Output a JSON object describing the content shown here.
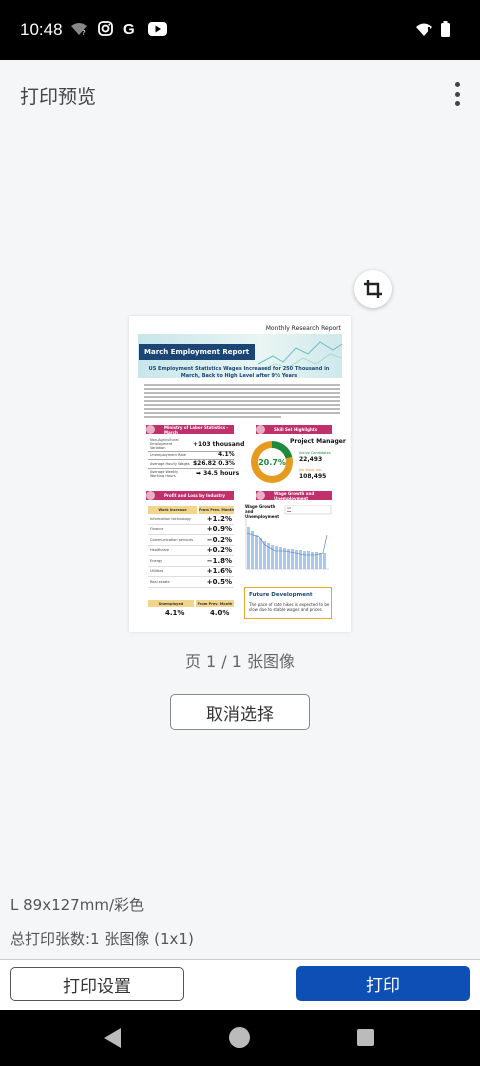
{
  "status_bar": {
    "time": "10:48"
  },
  "app_bar": {
    "title": "打印预览"
  },
  "document": {
    "header": "Monthly Research Report",
    "title": "March Employment Report",
    "subtitle": "US Employment Statistics   Wages Increased for 250 Thousand in March, Back to High Level after 9½ Years",
    "section_labor": "Ministry of Labor Statistics - March",
    "labor_rows": [
      {
        "label": "Non-Agricultural Employment Variation",
        "value": "+103 thousand"
      },
      {
        "label": "Unemployment Rate",
        "value": "4.1%"
      },
      {
        "label": "Average Hourly Wages",
        "value": "$26.82 0.3%"
      },
      {
        "label": "Average Weekly Working Hours",
        "value": "➡ 34.5 hours"
      }
    ],
    "section_skill": "Skill Set Highlights",
    "skill_role": "Project Manager",
    "skill_percent": "20.7%",
    "active_candidates_label": "Active Candidates",
    "active_candidates": "22,493",
    "job_count_label": "Job Want Ads",
    "job_count": "108,495",
    "section_pl": "Profit and Loss by Industry",
    "pl_header": [
      "Work Increase",
      "From Prev. Month"
    ],
    "pl_rows": [
      {
        "label": "Information technology",
        "value": "+1.2%"
      },
      {
        "label": "Finance",
        "value": "+0.9%"
      },
      {
        "label": "Communication services",
        "value": "−0.2%"
      },
      {
        "label": "Healthcare",
        "value": "+0.2%"
      },
      {
        "label": "Energy",
        "value": "−1.8%"
      },
      {
        "label": "Utilities",
        "value": "+1.6%"
      },
      {
        "label": "Real estate",
        "value": "+0.5%"
      }
    ],
    "unemployed_label": "Unemployed",
    "unemployed_value": "4.1%",
    "from_prev_label": "From Prev. Month",
    "from_prev_value": "4.0%",
    "section_wage": "Wage Growth and Unemployment",
    "chart_title": "Wage Growth and Unemployment",
    "future_title": "Future Development",
    "future_text": "The pace of rate hikes is expected to be slow due to stable wages and prices."
  },
  "page_indicator": "页 1 / 1 张图像",
  "deselect_label": "取消选择",
  "paper_size": "L 89x127mm/彩色",
  "total_count": "总打印张数:1 张图像 (1x1)",
  "print_settings_label": "打印设置",
  "print_label": "打印",
  "colors": {
    "primary": "#0d4fb4",
    "doc_navy": "#1a4575",
    "doc_pink": "#c0306a",
    "doc_gold": "#e69a1e",
    "doc_green": "#1e8a3a"
  }
}
